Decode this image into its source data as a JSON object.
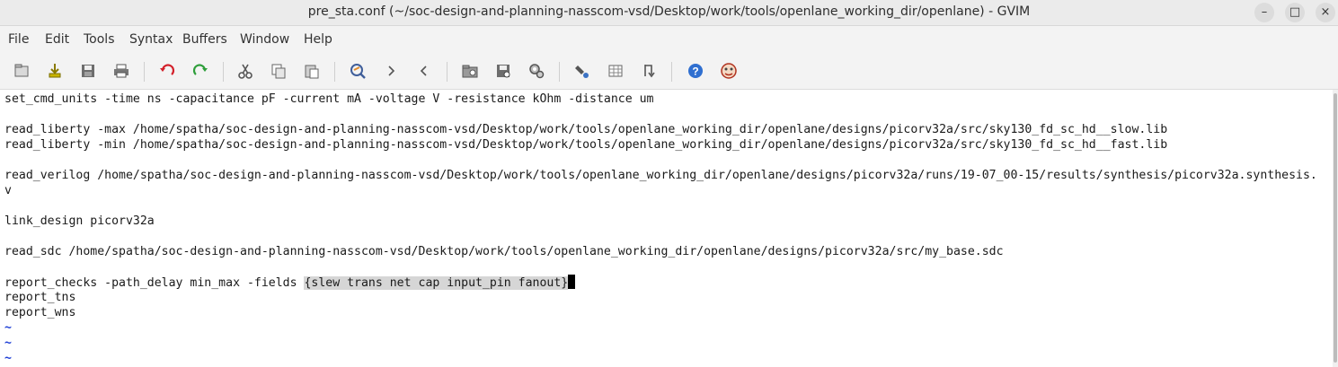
{
  "window": {
    "title": "pre_sta.conf (~/soc-design-and-planning-nasscom-vsd/Desktop/work/tools/openlane_working_dir/openlane) - GVIM",
    "minimize": "–",
    "maximize": "□",
    "close": "×"
  },
  "menu": [
    "File",
    "Edit",
    "Tools",
    "Syntax",
    "Buffers",
    "Window",
    "Help"
  ],
  "toolbar": {
    "icons": [
      "open-icon",
      "save-session-icon",
      "save-icon",
      "print-icon",
      "undo-icon",
      "redo-icon",
      "cut-icon",
      "copy-icon",
      "paste-icon",
      "find-replace-icon",
      "find-next-icon",
      "find-prev-icon",
      "load-session-icon",
      "save-session-icon",
      "run-script-icon",
      "make-icon",
      "build-tags-icon",
      "jump-tag-icon",
      "help-icon",
      "find-help-icon"
    ]
  },
  "editor": {
    "lines": [
      "set_cmd_units -time ns -capacitance pF -current mA -voltage V -resistance kOhm -distance um",
      "",
      "read_liberty -max /home/spatha/soc-design-and-planning-nasscom-vsd/Desktop/work/tools/openlane_working_dir/openlane/designs/picorv32a/src/sky130_fd_sc_hd__slow.lib",
      "read_liberty -min /home/spatha/soc-design-and-planning-nasscom-vsd/Desktop/work/tools/openlane_working_dir/openlane/designs/picorv32a/src/sky130_fd_sc_hd__fast.lib",
      "",
      "read_verilog /home/spatha/soc-design-and-planning-nasscom-vsd/Desktop/work/tools/openlane_working_dir/openlane/designs/picorv32a/runs/19-07_00-15/results/synthesis/picorv32a.synthesis.",
      "v",
      "",
      "link_design picorv32a",
      "",
      "read_sdc /home/spatha/soc-design-and-planning-nasscom-vsd/Desktop/work/tools/openlane_working_dir/openlane/designs/picorv32a/src/my_base.sdc",
      ""
    ],
    "report_checks_prefix": "report_checks -path_delay min_max -fields ",
    "report_checks_selected": "{slew trans net cap input_pin fanout",
    "report_checks_cursor": "}",
    "lines_after": [
      "report_tns",
      "report_wns"
    ],
    "tildes": [
      "~",
      "~",
      "~"
    ]
  }
}
